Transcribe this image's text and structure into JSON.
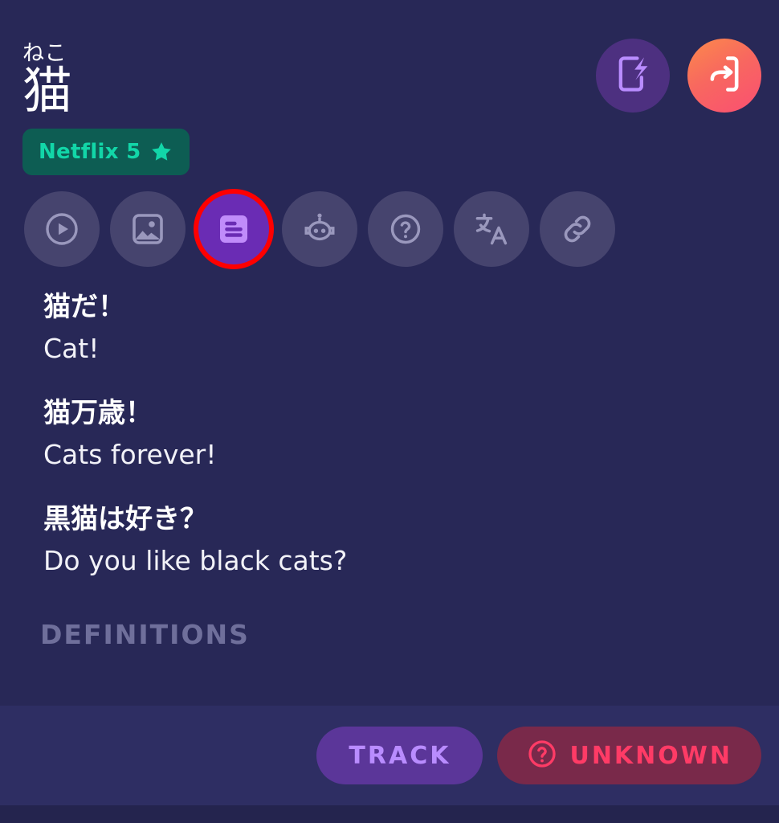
{
  "colors": {
    "background": "#282857",
    "bottom_bar": "#2e2e63",
    "footer_strip": "#24244e",
    "tab_inactive": "#46446e",
    "tab_active": "#6a2cb4",
    "tab_active_icon": "#c08cfa",
    "highlight_ring": "#ff0000",
    "badge_background": "#0d5d53",
    "badge_text": "#12d6a8",
    "flash_button": "#4d3080",
    "login_gradient_start": "#fb8a4b",
    "login_gradient_end": "#fa4f72",
    "track_background": "#5b3699",
    "track_text": "#b98cff",
    "unknown_background": "#79294a",
    "unknown_text": "#ff3b66",
    "section_label": "#6f6f9b",
    "text_primary": "#ffffff"
  },
  "header": {
    "furigana": "ねこ",
    "kanji": "猫",
    "badge": {
      "label": "Netflix 5",
      "icon": "star-icon"
    },
    "actions": [
      {
        "name": "flashcard-button",
        "icon": "flashcard-lightning-icon"
      },
      {
        "name": "login-button",
        "icon": "login-arrow-icon"
      }
    ]
  },
  "tabs": [
    {
      "name": "tab-video",
      "icon": "play-circle-icon",
      "active": false,
      "highlighted": false
    },
    {
      "name": "tab-images",
      "icon": "image-icon",
      "active": false,
      "highlighted": false
    },
    {
      "name": "tab-sentences",
      "icon": "document-lines-icon",
      "active": true,
      "highlighted": true
    },
    {
      "name": "tab-ai",
      "icon": "robot-icon",
      "active": false,
      "highlighted": false
    },
    {
      "name": "tab-quiz",
      "icon": "question-circle-icon",
      "active": false,
      "highlighted": false
    },
    {
      "name": "tab-translate",
      "icon": "translate-icon",
      "active": false,
      "highlighted": false
    },
    {
      "name": "tab-links",
      "icon": "link-icon",
      "active": false,
      "highlighted": false
    }
  ],
  "sentences": [
    {
      "jp": "猫だ！",
      "en": "Cat!"
    },
    {
      "jp": "猫万歳！",
      "en": "Cats forever!"
    },
    {
      "jp": "黒猫は好き？",
      "en": "Do you like black cats?"
    }
  ],
  "section_label": "DEFINITIONS",
  "bottom_bar": {
    "track_label": "TRACK",
    "unknown_label": "UNKNOWN",
    "unknown_icon": "question-circle-icon"
  }
}
